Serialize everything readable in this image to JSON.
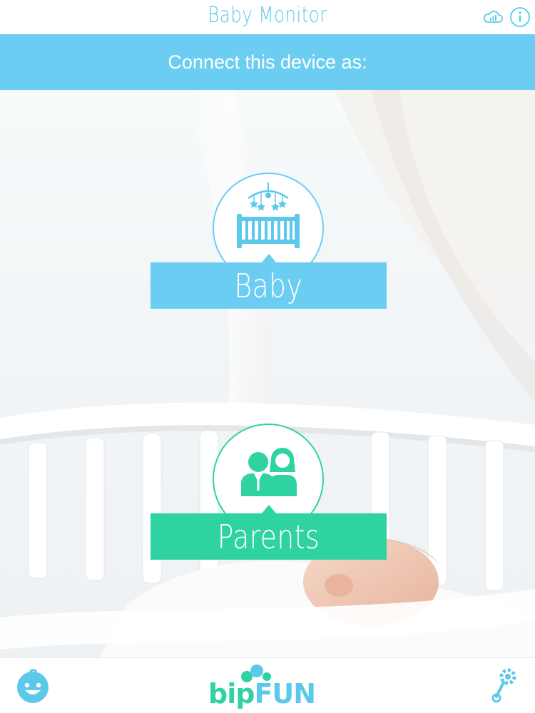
{
  "app": {
    "title": "Baby Monitor"
  },
  "banner": {
    "text": "Connect this device as:"
  },
  "choices": {
    "baby": {
      "label": "Baby",
      "icon": "crib-icon",
      "color": "#6ccdf2"
    },
    "parents": {
      "label": "Parents",
      "icon": "parents-icon",
      "color": "#2fd3a1"
    }
  },
  "footer": {
    "logo_part1": "bip",
    "logo_part2": "FUN",
    "left_icon": "baby-face-icon",
    "right_icon": "rattle-settings-icon"
  },
  "colors": {
    "accent_blue": "#6ccdf2",
    "accent_green": "#2fd3a1"
  }
}
